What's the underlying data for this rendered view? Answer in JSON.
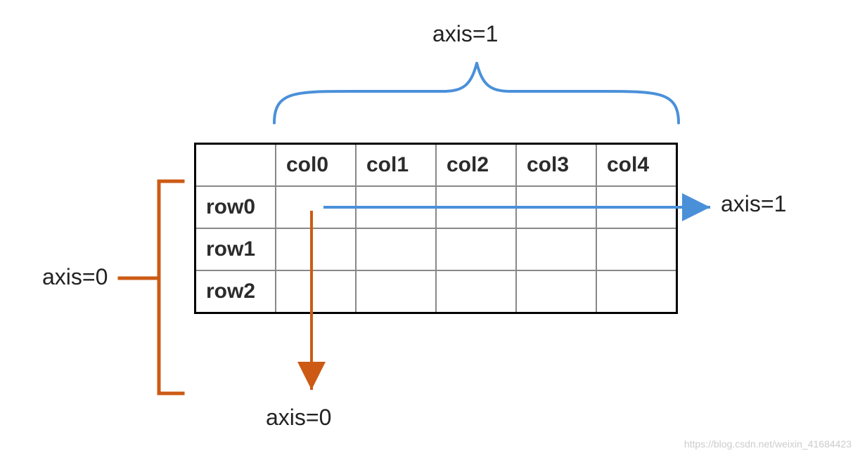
{
  "labels": {
    "axis1_top": "axis=1",
    "axis1_right": "axis=1",
    "axis0_left": "axis=0",
    "axis0_bottom": "axis=0"
  },
  "table": {
    "corner": "",
    "cols": [
      "col0",
      "col1",
      "col2",
      "col3",
      "col4"
    ],
    "rows": [
      "row0",
      "row1",
      "row2"
    ]
  },
  "colors": {
    "blue": "#4a90d9",
    "orange": "#cc5a14"
  },
  "watermark": "https://blog.csdn.net/weixin_41684423"
}
